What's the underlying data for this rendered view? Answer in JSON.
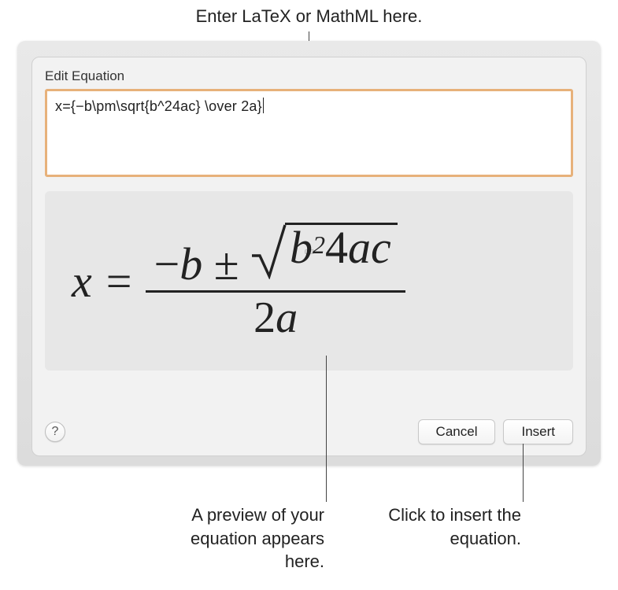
{
  "callouts": {
    "top": "Enter LaTeX or MathML here.",
    "bottom_left": "A preview of your equation appears here.",
    "bottom_right": "Click to insert the equation."
  },
  "dialog": {
    "title": "Edit Equation",
    "input_value": "x={−b\\pm\\sqrt{b^24ac} \\over 2a}",
    "help_label": "?",
    "cancel_label": "Cancel",
    "insert_label": "Insert"
  },
  "equation": {
    "lhs": "x",
    "eq": "=",
    "neg": "−",
    "b": "b",
    "pm": "±",
    "b2": "b",
    "exp": "2",
    "four": "4",
    "a": "a",
    "c": "c",
    "den2": "2",
    "dena": "a"
  }
}
